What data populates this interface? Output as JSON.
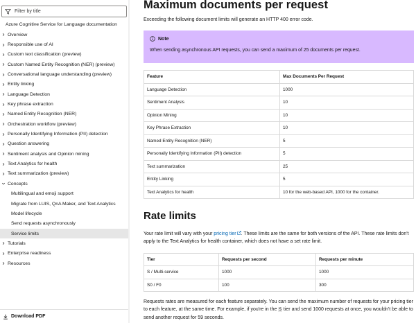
{
  "sidebar": {
    "filter_placeholder": "Filter by title",
    "root": "Azure Cognitive Service for Language documentation",
    "items": [
      {
        "label": "Overview",
        "expanded": false
      },
      {
        "label": "Responsible use of AI",
        "expanded": false
      },
      {
        "label": "Custom text classification (preview)",
        "expanded": false
      },
      {
        "label": "Custom Named Entity Recognition (NER) (preview)",
        "expanded": false
      },
      {
        "label": "Conversational language understanding (preview)",
        "expanded": false
      },
      {
        "label": "Entity linking",
        "expanded": false
      },
      {
        "label": "Language Detection",
        "expanded": false
      },
      {
        "label": "Key phrase extraction",
        "expanded": false
      },
      {
        "label": "Named Entity Recognition (NER)",
        "expanded": false
      },
      {
        "label": "Orchestration workflow (preview)",
        "expanded": false
      },
      {
        "label": "Personally Identifying Information (PII) detection",
        "expanded": false
      },
      {
        "label": "Question answering",
        "expanded": false
      },
      {
        "label": "Sentiment analysis and Opinion mining",
        "expanded": false
      },
      {
        "label": "Text Analytics for health",
        "expanded": false
      },
      {
        "label": "Text summarization (preview)",
        "expanded": false
      },
      {
        "label": "Concepts",
        "expanded": true
      },
      {
        "label": "Multilingual and emoji support",
        "sub": true
      },
      {
        "label": "Migrate from LUIS, QnA Maker, and Text Analytics",
        "sub": true
      },
      {
        "label": "Model lifecycle",
        "sub": true
      },
      {
        "label": "Send requests asynchronously",
        "sub": true
      },
      {
        "label": "Service limits",
        "sub": true,
        "selected": true
      },
      {
        "label": "Tutorials",
        "expanded": false
      },
      {
        "label": "Enterprise readiness",
        "expanded": false
      },
      {
        "label": "Resources",
        "expanded": false
      }
    ],
    "download_pdf": "Download PDF"
  },
  "main": {
    "heading": "Maximum documents per request",
    "intro": "Exceeding the following document limits will generate an HTTP 400 error code.",
    "note_title": "Note",
    "note_text": "When sending asynchronous API requests, you can send a maximum of 25 documents per request.",
    "doc_table": {
      "headers": [
        "Feature",
        "Max Documents Per Request"
      ],
      "rows": [
        [
          "Language Detection",
          "1000"
        ],
        [
          "Sentiment Analysis",
          "10"
        ],
        [
          "Opinion Mining",
          "10"
        ],
        [
          "Key Phrase Extraction",
          "10"
        ],
        [
          "Named Entity Recognition (NER)",
          "5"
        ],
        [
          "Personally Identifying Information (PII) detection",
          "5"
        ],
        [
          "Text summarization",
          "25"
        ],
        [
          "Entity Linking",
          "5"
        ],
        [
          "Text Analytics for health",
          "10 for the web-based API, 1000 for the container."
        ]
      ]
    },
    "rate_heading": "Rate limits",
    "rate_text_1": "Your rate limit will vary with your ",
    "rate_link": "pricing tier",
    "rate_text_2": ". These limits are the same for both versions of the API. These rate limits don't apply to the Text Analytics for health container, which does not have a set rate limit.",
    "rate_table": {
      "headers": [
        "Tier",
        "Requests per second",
        "Requests per minute"
      ],
      "rows": [
        [
          "S / Multi-service",
          "1000",
          "1000"
        ],
        [
          "S0 / F0",
          "100",
          "300"
        ]
      ]
    },
    "footer_text_1": "Requests rates are measured for each feature separately. You can send the maximum number of requests for your pricing tier to each feature, at the same time. For example, if you're in the ",
    "footer_code": "S",
    "footer_text_2": " tier and send 1000 requests at once, you wouldn't be able to send another request for 59 seconds.",
    "accent_color": "#d8b9ff",
    "link_color": "#0065b3"
  }
}
